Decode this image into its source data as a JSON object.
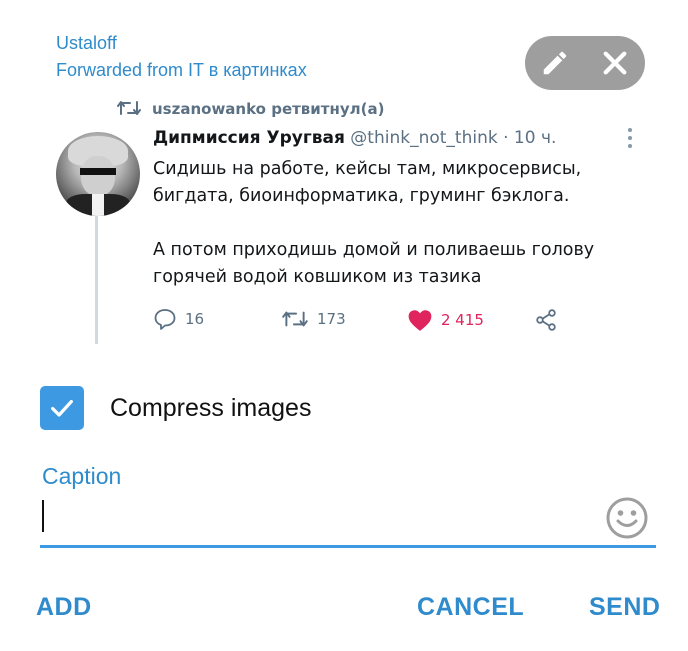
{
  "forward": {
    "sender": "Ustaloff",
    "forwarded_from": "Forwarded from IT в картинках"
  },
  "tweet": {
    "retweeted_by": "uszanowanko ретвитнул(а)",
    "author_name": "Дипмиссия Уругвая",
    "author_handle": "@think_not_think",
    "time": "· 10 ч.",
    "text_lines_1": [
      "Сидишь на работе, кейсы там, микросервисы,",
      "бигдата, биоинформатика, груминг бэклога."
    ],
    "text_lines_2": [
      "А потом приходишь домой и поливаешь голову",
      "горячей водой ковшиком из тазика"
    ],
    "replies": "16",
    "retweets": "173",
    "likes": "2 415"
  },
  "options": {
    "compress_label": "Compress images",
    "compress_checked": true
  },
  "caption": {
    "label": "Caption",
    "value": ""
  },
  "actions": {
    "add": "ADD",
    "cancel": "CANCEL",
    "send": "SEND"
  },
  "colors": {
    "accent": "#2f8bcc",
    "checkbox": "#3d9ae2",
    "pill": "#9e9e9e",
    "like": "#e0245e"
  }
}
